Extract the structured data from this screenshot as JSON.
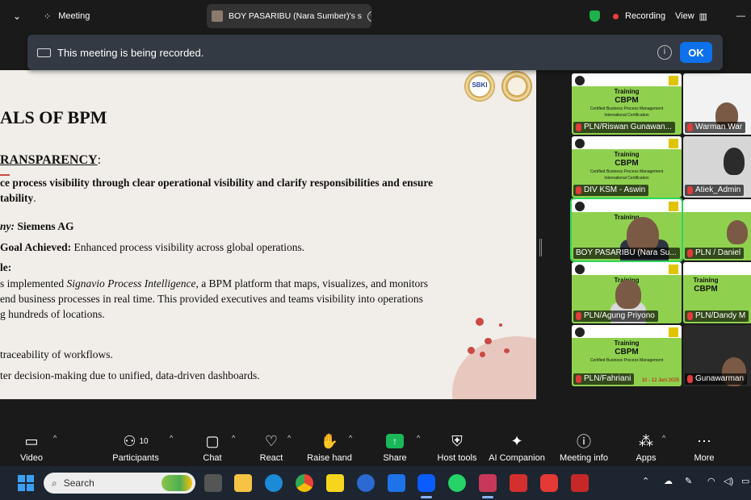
{
  "topbar": {
    "meeting_label": "Meeting",
    "speaker_label": "BOY PASARIBU (Nara Sumber)'s s",
    "recording_label": "Recording",
    "view_label": "View"
  },
  "banner": {
    "message": "This meeting is being recorded.",
    "ok_label": "OK",
    "info_glyph": "i"
  },
  "slide": {
    "title": "ALS OF BPM",
    "heading": "RANSPARENCY",
    "heading_suffix": ":",
    "line1": "ce process visibility through clear operational visibility and clarify responsibilities and ensure",
    "line2": "tability",
    "line2_suffix": ".",
    "company_label": "ny: ",
    "company_value": "Siemens AG",
    "goal_label": "Goal Achieved: ",
    "goal_value": "Enhanced process visibility across global operations.",
    "example_label": "le:",
    "ex1_a": "s implemented ",
    "ex1_b": "Signavio Process Intelligence",
    "ex1_c": ", a BPM platform that maps, visualizes, and monitors",
    "ex2": "end business processes in real time. This provided executives and teams visibility into operations",
    "ex3": "g hundreds of locations.",
    "bullet1": " traceability of workflows.",
    "bullet2": "ter decision-making due to unified, data-driven dashboards.",
    "seal_text": "SBKI"
  },
  "gallery": {
    "training": "Training",
    "cbpm": "CBPM",
    "subtitle": "Certified Business Process Management",
    "cert": "International Certification",
    "date": "10 - 12 Juni  2025",
    "participants": [
      "PLN/Riswan Gunawan...",
      "Warman War",
      "DIV KSM - Aswin",
      "Atiek_Admin",
      "BOY PASARIBU (Nara Su...",
      "PLN / Daniel",
      "PLN/Agung Priyono",
      "PLN/Dandy M",
      "PLN/Fahriani",
      "Gunawarman"
    ]
  },
  "toolbar": {
    "video": "Video",
    "participants": "Participants",
    "participants_count": "10",
    "chat": "Chat",
    "react": "React",
    "raise_hand": "Raise hand",
    "share": "Share",
    "host_tools": "Host tools",
    "ai_companion": "AI Companion",
    "meeting_info": "Meeting info",
    "apps": "Apps",
    "more": "More"
  },
  "taskbar": {
    "search_placeholder": "Search"
  },
  "colors": {
    "accent_blue": "#0e71eb",
    "recording_red": "#ef3e3e",
    "share_green": "#19b85a",
    "training_green": "#8fd14f"
  }
}
